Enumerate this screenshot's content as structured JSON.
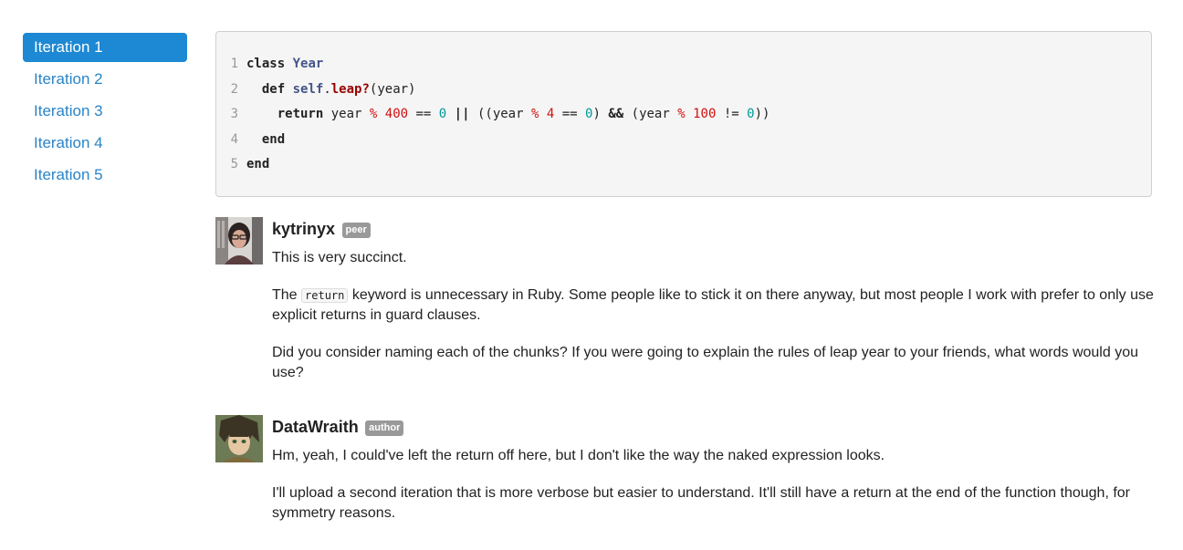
{
  "sidebar": {
    "items": [
      {
        "label": "Iteration 1"
      },
      {
        "label": "Iteration 2"
      },
      {
        "label": "Iteration 3"
      },
      {
        "label": "Iteration 4"
      },
      {
        "label": "Iteration 5"
      }
    ],
    "active_index": 0
  },
  "code": {
    "lines": [
      {
        "n": "1",
        "text": "class Year"
      },
      {
        "n": "2",
        "text": "  def self.leap?(year)"
      },
      {
        "n": "3",
        "text": "    return year % 400 == 0 || ((year % 4 == 0) && (year % 100 != 0))"
      },
      {
        "n": "4",
        "text": "  end"
      },
      {
        "n": "5",
        "text": "end"
      }
    ],
    "tokens": {
      "l1": [
        "class",
        "Year"
      ],
      "l2": [
        "def",
        "self",
        ".",
        "leap?",
        "(year)"
      ],
      "l3": [
        "return",
        "year",
        "%",
        "400",
        "==",
        "0",
        "||",
        "((year",
        "%",
        "4",
        "==",
        "0",
        ")",
        "&&",
        "(year",
        "%",
        "100",
        "!=",
        "0",
        "))"
      ],
      "l4": [
        "end"
      ],
      "l5": [
        "end"
      ]
    }
  },
  "comments": [
    {
      "username": "kytrinyx",
      "badge": "peer",
      "paragraphs": {
        "p1": "This is very succinct.",
        "p2_before": "The",
        "p2_code": "return",
        "p2_after": "keyword is unnecessary in Ruby. Some people like to stick it on there anyway, but most people I work with prefer to only use explicit returns in guard clauses.",
        "p3": "Did you consider naming each of the chunks? If you were going to explain the rules of leap year to your friends, what words would you use?"
      }
    },
    {
      "username": "DataWraith",
      "badge": "author",
      "paragraphs": {
        "p1": "Hm, yeah, I could've left the return off here, but I don't like the way the naked expression looks.",
        "p2": "I'll upload a second iteration that is more verbose but easier to understand. It'll still have a return at the end of the function though, for symmetry reasons."
      }
    }
  ],
  "colors": {
    "accent": "#1d88d3",
    "link": "#2a84c7",
    "badge": "#999999"
  }
}
